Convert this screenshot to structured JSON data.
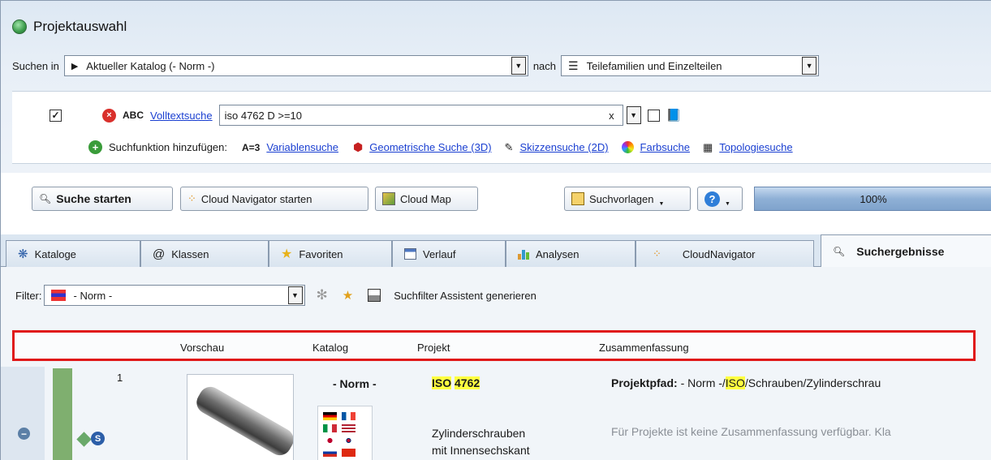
{
  "window": {
    "title": "Projektauswahl"
  },
  "search_row": {
    "search_in_label": "Suchen in",
    "catalog_value": "Aktueller Katalog (- Norm -)",
    "by_label": "nach",
    "mode_value": "Teilefamilien und Einzelteilen"
  },
  "fulltext": {
    "type_label": "ABC",
    "link": "Volltextsuche",
    "query": "iso 4762 D >=10",
    "clear": "x"
  },
  "add_function": {
    "label": "Suchfunktion hinzufügen:",
    "var_prefix": "A=3",
    "items": [
      "Variablensuche",
      "Geometrische Suche (3D)",
      "Skizzensuche (2D)",
      "Farbsuche",
      "Topologiesuche"
    ]
  },
  "buttons": {
    "start": "Suche starten",
    "cloud_nav": "Cloud Navigator starten",
    "cloud_map": "Cloud Map",
    "templates": "Suchvorlagen",
    "progress": "100%"
  },
  "tabs": [
    "Kataloge",
    "Klassen",
    "Favoriten",
    "Verlauf",
    "Analysen",
    "CloudNavigator",
    "Suchergebnisse"
  ],
  "filter": {
    "label": "Filter:",
    "value": "- Norm -",
    "assistant": "Suchfilter Assistent generieren"
  },
  "columns": [
    "Vorschau",
    "Katalog",
    "Projekt",
    "Zusammenfassung"
  ],
  "result": {
    "index": "1",
    "catalog": "- Norm -",
    "project_title_a": "ISO",
    "project_title_b": "4762",
    "project_desc_1": "Zylinderschrauben",
    "project_desc_2": "mit Innensechskant",
    "path_label": "Projektpfad:",
    "path_prefix": "- Norm -/",
    "path_hl": "ISO",
    "path_rest": "/Schrauben/Zylinderschrau",
    "summary": "Für Projekte ist keine Zusammenfassung verfügbar. Kla"
  },
  "colors": {
    "highlight": "#ffff40",
    "red_frame": "#e01919",
    "link": "#1a3fd1",
    "progress": "#8fb0d6"
  }
}
